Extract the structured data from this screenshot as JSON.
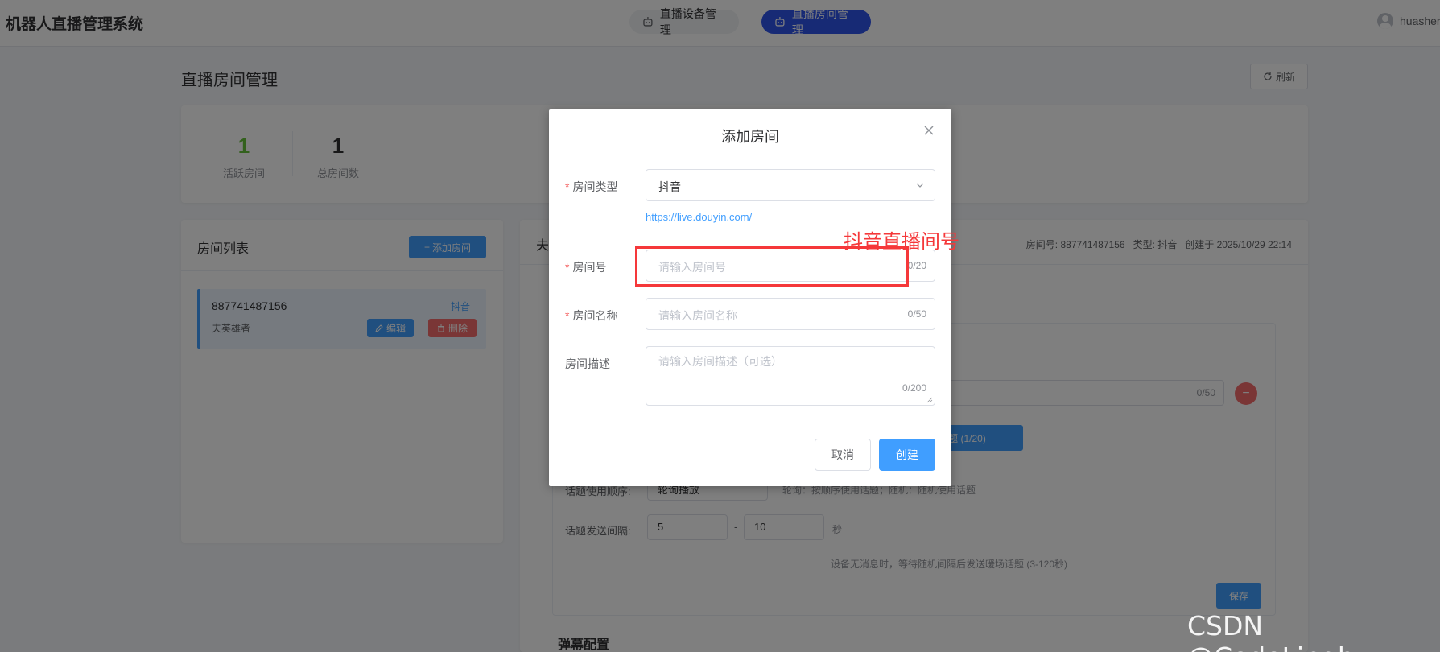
{
  "header": {
    "app_title": "机器人直播管理系统",
    "nav": [
      {
        "label": "直播设备管理",
        "active": false
      },
      {
        "label": "直播房间管理",
        "active": true
      }
    ],
    "user": "huashen"
  },
  "page": {
    "title": "直播房间管理",
    "refresh_label": "刷新"
  },
  "stats": {
    "active_count": "1",
    "active_label": "活跃房间",
    "total_count": "1",
    "total_label": "总房间数"
  },
  "room_list": {
    "title": "房间列表",
    "add_label": "添加房间",
    "items": [
      {
        "room_id": "887741487156",
        "type": "抖音",
        "name": "夫英雄者",
        "edit_label": "编辑",
        "delete_label": "删除"
      }
    ]
  },
  "detail": {
    "title": "夫",
    "meta": {
      "room_no": "房间号: 887741487156",
      "type": "类型: 抖音",
      "created": "创建于 2025/10/29 22:14"
    },
    "topic_counter": "0/50",
    "add_topic_label": "话题 (1/20)",
    "order_label": "话题使用顺序:",
    "order_value": "轮询播放",
    "order_hint": "轮询：按顺序使用话题；随机：随机使用话题",
    "interval_label": "话题发送间隔:",
    "interval_min": "5",
    "interval_max": "10",
    "interval_unit": "秒",
    "interval_dash": "-",
    "idle_hint": "设备无消息时，等待随机间隔后发送暖场话题 (3-120秒)",
    "save_label": "保存",
    "danmaku_title": "弹幕配置"
  },
  "dialog": {
    "title": "添加房间",
    "type_label": "房间类型",
    "type_value": "抖音",
    "link": "https://live.douyin.com/",
    "room_no_label": "房间号",
    "room_no_placeholder": "请输入房间号",
    "room_no_count": "0/20",
    "room_name_label": "房间名称",
    "room_name_placeholder": "请输入房间名称",
    "room_name_count": "0/50",
    "desc_label": "房间描述",
    "desc_placeholder": "请输入房间描述（可选）",
    "desc_count": "0/200",
    "cancel_label": "取消",
    "create_label": "创建"
  },
  "annotation": {
    "text": "抖音直播间号",
    "color": "#f5383a"
  },
  "watermark": "CSDN @CodeLinghu",
  "colors": {
    "primary": "#409eff",
    "nav_active": "#2f54eb",
    "danger": "#f56c6c",
    "success": "#67c23a"
  }
}
